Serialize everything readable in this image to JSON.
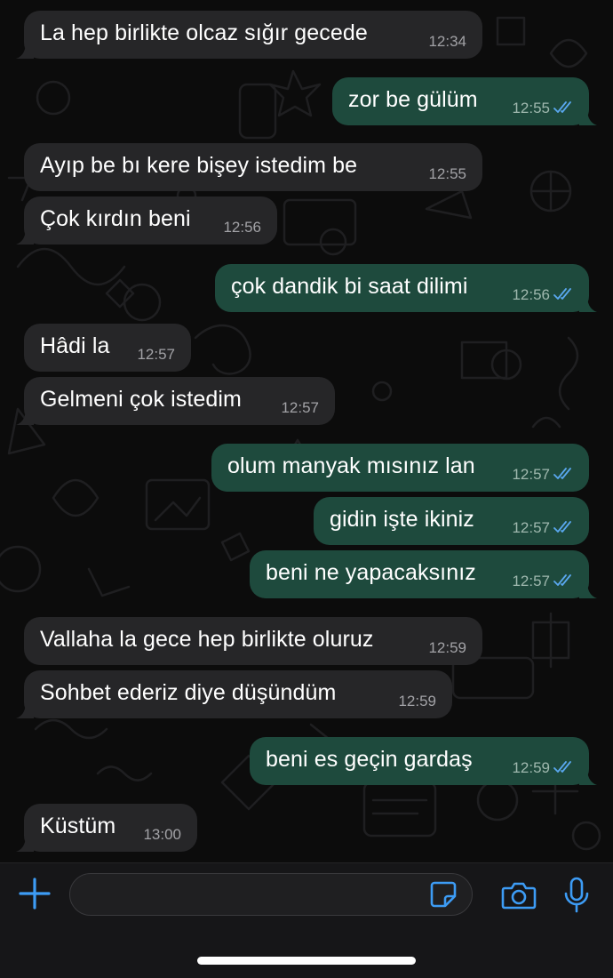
{
  "messages": [
    {
      "direction": "incoming",
      "text": "La hep birlikte olcaz sığır gecede",
      "time": "12:34"
    },
    {
      "direction": "outgoing",
      "text": "zor be gülüm",
      "time": "12:55",
      "status": "read"
    },
    {
      "direction": "incoming",
      "text": "Ayıp be bı kere bişey istedim be",
      "time": "12:55"
    },
    {
      "direction": "incoming",
      "text": "Çok kırdın beni",
      "time": "12:56"
    },
    {
      "direction": "outgoing",
      "text": "çok dandik bi saat dilimi",
      "time": "12:56",
      "status": "read"
    },
    {
      "direction": "incoming",
      "text": "Hâdi la",
      "time": "12:57"
    },
    {
      "direction": "incoming",
      "text": "Gelmeni çok istedim",
      "time": "12:57"
    },
    {
      "direction": "outgoing",
      "text": "olum manyak mısınız lan",
      "time": "12:57",
      "status": "read"
    },
    {
      "direction": "outgoing",
      "text": "gidin işte ikiniz",
      "time": "12:57",
      "status": "read"
    },
    {
      "direction": "outgoing",
      "text": "beni ne yapacaksınız",
      "time": "12:57",
      "status": "read"
    },
    {
      "direction": "incoming",
      "text": "Vallaha la gece hep birlikte oluruz",
      "time": "12:59"
    },
    {
      "direction": "incoming",
      "text": "Sohbet ederiz diye düşündüm",
      "time": "12:59"
    },
    {
      "direction": "outgoing",
      "text": "beni es geçin gardaş",
      "time": "12:59",
      "status": "read"
    },
    {
      "direction": "incoming",
      "text": "Küstüm",
      "time": "13:00"
    }
  ],
  "input_bar": {
    "message_value": "",
    "icons": [
      "plus-icon",
      "sticker-icon",
      "camera-icon",
      "microphone-icon"
    ]
  },
  "colors": {
    "accent": "#3d9cf5",
    "incoming_bubble": "#262628",
    "outgoing_bubble": "#1e4a3d",
    "read_ticks": "#5aa8f0"
  }
}
